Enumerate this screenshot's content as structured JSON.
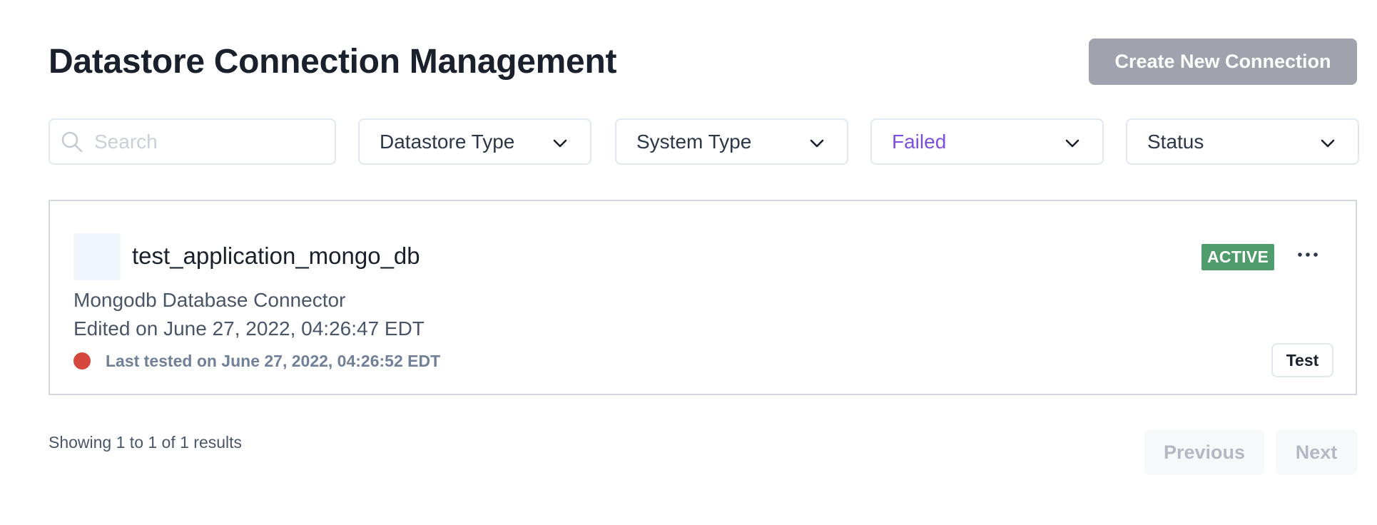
{
  "header": {
    "title": "Datastore Connection Management",
    "create_button_label": "Create New Connection"
  },
  "filters": {
    "search_placeholder": "Search",
    "search_value": "",
    "datastore_type": "Datastore Type",
    "system_type": "System Type",
    "test_status": "Failed",
    "status": "Status"
  },
  "connections": [
    {
      "name": "test_application_mongo_db",
      "badge": "ACTIVE",
      "connector": "Mongodb Database Connector",
      "edited": "Edited on June 27, 2022, 04:26:47 EDT",
      "last_tested": "Last tested on June 27, 2022, 04:26:52 EDT",
      "test_status_color": "#d6473f",
      "test_button_label": "Test"
    }
  ],
  "pagination": {
    "summary": "Showing 1 to 1 of 1 results",
    "previous_label": "Previous",
    "next_label": "Next"
  },
  "colors": {
    "accent_selected": "#7b4fe0",
    "active_badge": "#509c6d",
    "failed_dot": "#d6473f",
    "disabled_button": "#a0a3ad"
  },
  "icons": {
    "search": "search-icon",
    "dropdown": "chevron-down-icon",
    "more": "more-horizontal-icon"
  }
}
